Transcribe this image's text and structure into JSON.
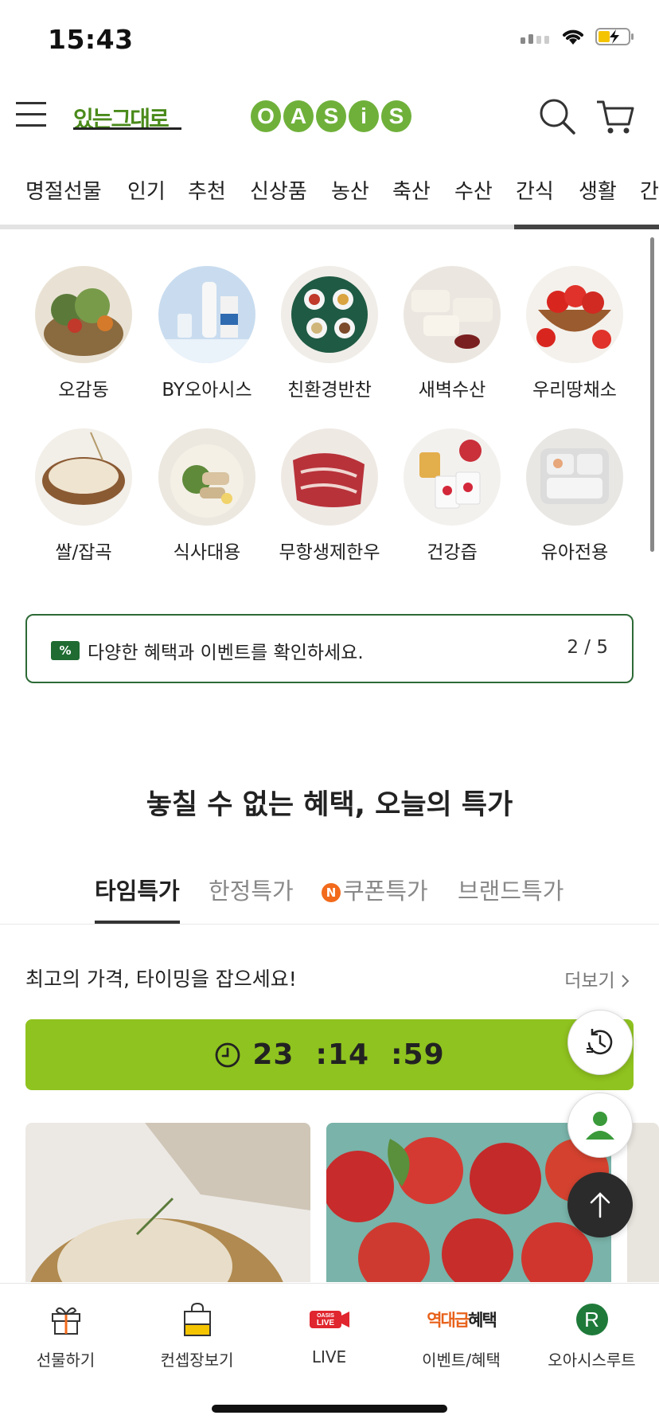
{
  "status_bar": {
    "time": "15:43"
  },
  "header": {
    "brand_sub": "있는그대로",
    "logo_letters": [
      "O",
      "A",
      "S",
      "i",
      "S"
    ],
    "brand_color": "#6fb03a"
  },
  "category_nav": [
    "명절선물",
    "인기",
    "추천",
    "신상품",
    "농산",
    "축산",
    "수산",
    "간식",
    "생활",
    "간"
  ],
  "quick_categories": [
    {
      "label": "오감동",
      "icon": "vegetable-basket"
    },
    {
      "label": "BY오아시스",
      "icon": "milk-bottle"
    },
    {
      "label": "친환경반찬",
      "icon": "side-dishes"
    },
    {
      "label": "새벽수산",
      "icon": "fish-fillet"
    },
    {
      "label": "우리땅채소",
      "icon": "tomato-bowl"
    },
    {
      "label": "쌀/잡곡",
      "icon": "rice-bowl"
    },
    {
      "label": "식사대용",
      "icon": "salad-plate"
    },
    {
      "label": "무항생제한우",
      "icon": "beef"
    },
    {
      "label": "건강즙",
      "icon": "juice-packs"
    },
    {
      "label": "유아전용",
      "icon": "baby-tray"
    }
  ],
  "benefit_banner": {
    "badge": "%",
    "text": "다양한 혜택과 이벤트를 확인하세요.",
    "page": "2 / 5"
  },
  "section": {
    "title": "놓칠 수 없는 혜택, 오늘의 특가",
    "tabs": [
      {
        "label": "타임특가",
        "active": true
      },
      {
        "label": "한정특가",
        "active": false
      },
      {
        "label": "쿠폰특가",
        "active": false,
        "badge": "N"
      },
      {
        "label": "브랜드특가",
        "active": false
      }
    ]
  },
  "promo": {
    "text": "최고의 가격, 타이밍을 잡으세요!",
    "more": "더보기"
  },
  "timer": {
    "h": "23",
    "m": "14",
    "s": "59",
    "color": "#8fc31f"
  },
  "bottom_bar": [
    {
      "label": "선물하기",
      "icon": "gift-icon"
    },
    {
      "label": "컨셉장보기",
      "icon": "shopping-bag-icon"
    },
    {
      "label": "LIVE",
      "icon": "live-icon",
      "icon_text": "OASIS LIVE"
    },
    {
      "label": "이벤트/혜택",
      "icon": "event-icon",
      "icon_text_a": "역대급",
      "icon_text_b": "혜택"
    },
    {
      "label": "오아시스루트",
      "icon": "route-icon",
      "icon_text": "R"
    }
  ]
}
